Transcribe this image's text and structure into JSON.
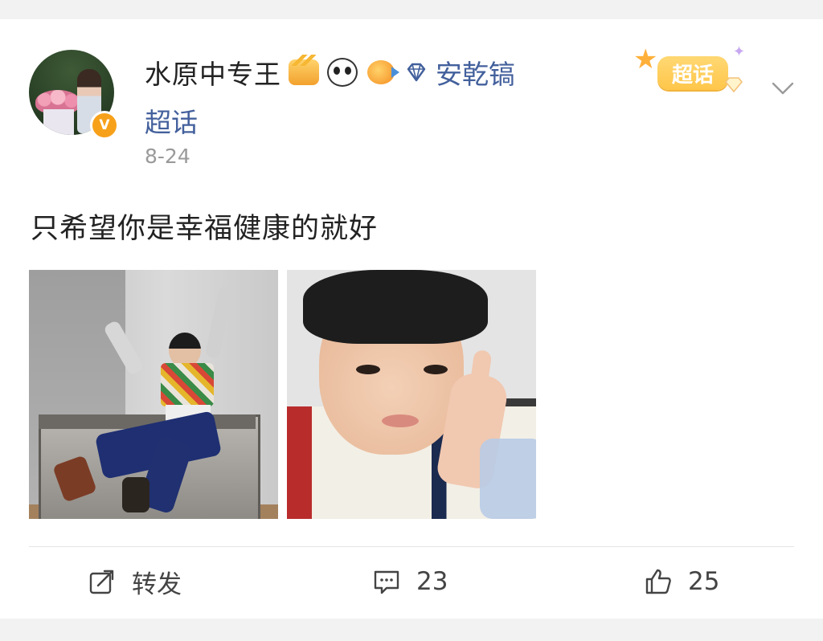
{
  "post": {
    "username": "水原中专王",
    "topic_name": "安乾镐",
    "topic_suffix": "超话",
    "date": "8-24",
    "verified_mark": "V",
    "text": "只希望你是幸福健康的就好",
    "badge_label": "超话",
    "icons": [
      "crown-badge-icon",
      "panda-badge-icon",
      "fish-badge-icon",
      "diamond-icon",
      "chevron-down-icon"
    ]
  },
  "actions": {
    "repost_label": "转发",
    "comment_count": "23",
    "like_count": "25"
  },
  "colors": {
    "link": "#43609c",
    "verified": "#f7a11a",
    "badge": "#ffc64a"
  }
}
